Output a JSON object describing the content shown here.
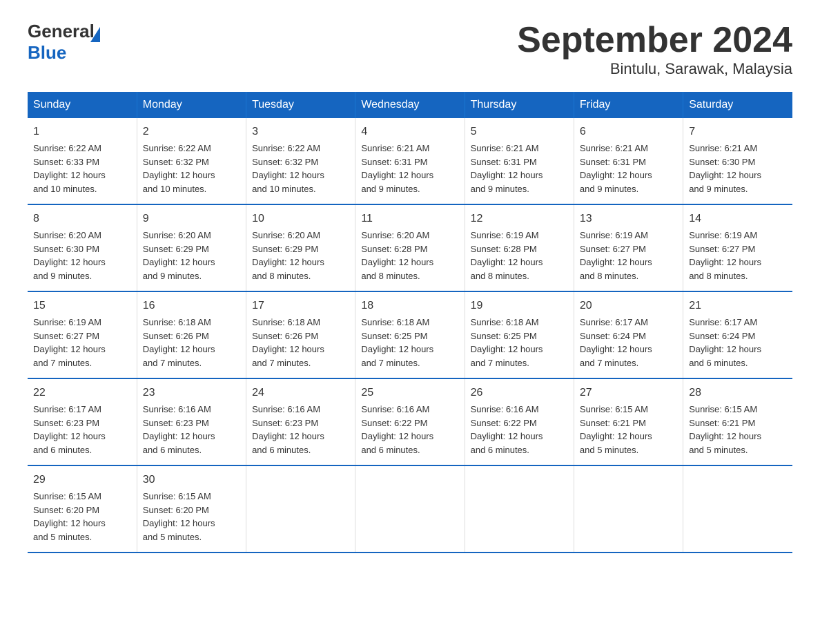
{
  "header": {
    "logo_general": "General",
    "logo_blue": "Blue",
    "month_title": "September 2024",
    "location": "Bintulu, Sarawak, Malaysia"
  },
  "weekdays": [
    "Sunday",
    "Monday",
    "Tuesday",
    "Wednesday",
    "Thursday",
    "Friday",
    "Saturday"
  ],
  "weeks": [
    [
      {
        "day": "1",
        "info": "Sunrise: 6:22 AM\nSunset: 6:33 PM\nDaylight: 12 hours\nand 10 minutes."
      },
      {
        "day": "2",
        "info": "Sunrise: 6:22 AM\nSunset: 6:32 PM\nDaylight: 12 hours\nand 10 minutes."
      },
      {
        "day": "3",
        "info": "Sunrise: 6:22 AM\nSunset: 6:32 PM\nDaylight: 12 hours\nand 10 minutes."
      },
      {
        "day": "4",
        "info": "Sunrise: 6:21 AM\nSunset: 6:31 PM\nDaylight: 12 hours\nand 9 minutes."
      },
      {
        "day": "5",
        "info": "Sunrise: 6:21 AM\nSunset: 6:31 PM\nDaylight: 12 hours\nand 9 minutes."
      },
      {
        "day": "6",
        "info": "Sunrise: 6:21 AM\nSunset: 6:31 PM\nDaylight: 12 hours\nand 9 minutes."
      },
      {
        "day": "7",
        "info": "Sunrise: 6:21 AM\nSunset: 6:30 PM\nDaylight: 12 hours\nand 9 minutes."
      }
    ],
    [
      {
        "day": "8",
        "info": "Sunrise: 6:20 AM\nSunset: 6:30 PM\nDaylight: 12 hours\nand 9 minutes."
      },
      {
        "day": "9",
        "info": "Sunrise: 6:20 AM\nSunset: 6:29 PM\nDaylight: 12 hours\nand 9 minutes."
      },
      {
        "day": "10",
        "info": "Sunrise: 6:20 AM\nSunset: 6:29 PM\nDaylight: 12 hours\nand 8 minutes."
      },
      {
        "day": "11",
        "info": "Sunrise: 6:20 AM\nSunset: 6:28 PM\nDaylight: 12 hours\nand 8 minutes."
      },
      {
        "day": "12",
        "info": "Sunrise: 6:19 AM\nSunset: 6:28 PM\nDaylight: 12 hours\nand 8 minutes."
      },
      {
        "day": "13",
        "info": "Sunrise: 6:19 AM\nSunset: 6:27 PM\nDaylight: 12 hours\nand 8 minutes."
      },
      {
        "day": "14",
        "info": "Sunrise: 6:19 AM\nSunset: 6:27 PM\nDaylight: 12 hours\nand 8 minutes."
      }
    ],
    [
      {
        "day": "15",
        "info": "Sunrise: 6:19 AM\nSunset: 6:27 PM\nDaylight: 12 hours\nand 7 minutes."
      },
      {
        "day": "16",
        "info": "Sunrise: 6:18 AM\nSunset: 6:26 PM\nDaylight: 12 hours\nand 7 minutes."
      },
      {
        "day": "17",
        "info": "Sunrise: 6:18 AM\nSunset: 6:26 PM\nDaylight: 12 hours\nand 7 minutes."
      },
      {
        "day": "18",
        "info": "Sunrise: 6:18 AM\nSunset: 6:25 PM\nDaylight: 12 hours\nand 7 minutes."
      },
      {
        "day": "19",
        "info": "Sunrise: 6:18 AM\nSunset: 6:25 PM\nDaylight: 12 hours\nand 7 minutes."
      },
      {
        "day": "20",
        "info": "Sunrise: 6:17 AM\nSunset: 6:24 PM\nDaylight: 12 hours\nand 7 minutes."
      },
      {
        "day": "21",
        "info": "Sunrise: 6:17 AM\nSunset: 6:24 PM\nDaylight: 12 hours\nand 6 minutes."
      }
    ],
    [
      {
        "day": "22",
        "info": "Sunrise: 6:17 AM\nSunset: 6:23 PM\nDaylight: 12 hours\nand 6 minutes."
      },
      {
        "day": "23",
        "info": "Sunrise: 6:16 AM\nSunset: 6:23 PM\nDaylight: 12 hours\nand 6 minutes."
      },
      {
        "day": "24",
        "info": "Sunrise: 6:16 AM\nSunset: 6:23 PM\nDaylight: 12 hours\nand 6 minutes."
      },
      {
        "day": "25",
        "info": "Sunrise: 6:16 AM\nSunset: 6:22 PM\nDaylight: 12 hours\nand 6 minutes."
      },
      {
        "day": "26",
        "info": "Sunrise: 6:16 AM\nSunset: 6:22 PM\nDaylight: 12 hours\nand 6 minutes."
      },
      {
        "day": "27",
        "info": "Sunrise: 6:15 AM\nSunset: 6:21 PM\nDaylight: 12 hours\nand 5 minutes."
      },
      {
        "day": "28",
        "info": "Sunrise: 6:15 AM\nSunset: 6:21 PM\nDaylight: 12 hours\nand 5 minutes."
      }
    ],
    [
      {
        "day": "29",
        "info": "Sunrise: 6:15 AM\nSunset: 6:20 PM\nDaylight: 12 hours\nand 5 minutes."
      },
      {
        "day": "30",
        "info": "Sunrise: 6:15 AM\nSunset: 6:20 PM\nDaylight: 12 hours\nand 5 minutes."
      },
      {
        "day": "",
        "info": ""
      },
      {
        "day": "",
        "info": ""
      },
      {
        "day": "",
        "info": ""
      },
      {
        "day": "",
        "info": ""
      },
      {
        "day": "",
        "info": ""
      }
    ]
  ]
}
